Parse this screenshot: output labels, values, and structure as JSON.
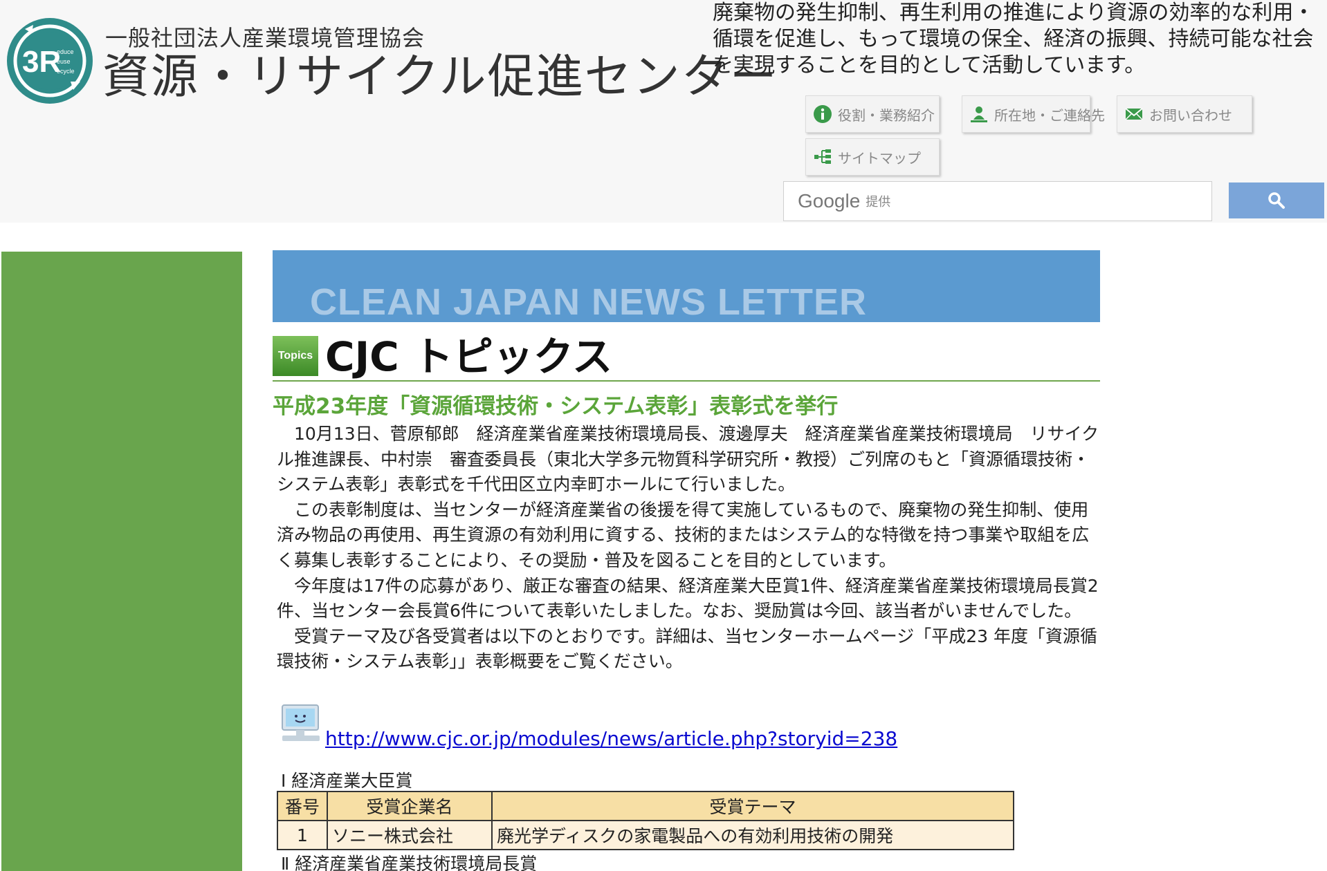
{
  "header": {
    "logo_text": "3R",
    "logo_subtext": [
      "educe",
      "euse",
      "ecycle"
    ],
    "org_subtitle": "一般社団法人産業環境管理協会",
    "org_name": "資源・リサイクル促進センター",
    "mission_text": "廃棄物の発生抑制、再生利用の推進により資源の効率的な利用・循環を促進し、もって環境の保全、経済の振興、持続可能な社会を実現することを目的として活動しています。"
  },
  "nav": {
    "role_label": "役割・業務紹介",
    "location_label": "所在地・ご連絡先",
    "contact_label": "お問い合わせ",
    "sitemap_label": "サイトマップ"
  },
  "search": {
    "brand": "Google",
    "brand_suffix": "提供"
  },
  "banner": {
    "title": "CLEAN JAPAN NEWS LETTER"
  },
  "topics": {
    "badge": "Topics",
    "title": "CJC トピックス"
  },
  "article": {
    "title": "平成23年度「資源循環技術・システム表彰」表彰式を挙行",
    "paragraphs": [
      "10月13日、菅原郁郎　経済産業省産業技術環境局長、渡邊厚夫　経済産業省産業技術環境局　リサイクル推進課長、中村崇　審査委員長（東北大学多元物質科学研究所・教授）ご列席のもと「資源循環技術・システム表彰」表彰式を千代田区立内幸町ホールにて行いました。",
      "この表彰制度は、当センターが経済産業省の後援を得て実施しているもので、廃棄物の発生抑制、使用済み物品の再使用、再生資源の有効利用に資する、技術的またはシステム的な特徴を持つ事業や取組を広く募集し表彰することにより、その奨励・普及を図ることを目的としています。",
      "今年度は17件の応募があり、厳正な審査の結果、経済産業大臣賞1件、経済産業省産業技術環境局長賞2件、当センター会長賞6件について表彰いたしました。なお、奨励賞は今回、該当者がいませんでした。",
      "受賞テーマ及び各受賞者は以下のとおりです。詳細は、当センターホームページ「平成23 年度「資源循環技術・システム表彰」」表彰概要をご覧ください。"
    ],
    "link": "http://www.cjc.or.jp/modules/news/article.php?storyid=238"
  },
  "awards": {
    "section1": "Ⅰ 経済産業大臣賞",
    "section2": "Ⅱ 経済産業省産業技術環境局長賞",
    "headers": [
      "番号",
      "受賞企業名",
      "受賞テーマ"
    ],
    "rows": [
      [
        "1",
        "ソニー株式会社",
        "廃光学ディスクの家電製品への有効利用技術の開発"
      ]
    ]
  },
  "colors": {
    "accent_green": "#5ba53a",
    "sidebar_green": "#69a54d",
    "banner_blue": "#5b9ad0",
    "link_blue": "#0a0ad0",
    "table_header": "#f7dfa5",
    "table_cell": "#fdf1dc"
  }
}
